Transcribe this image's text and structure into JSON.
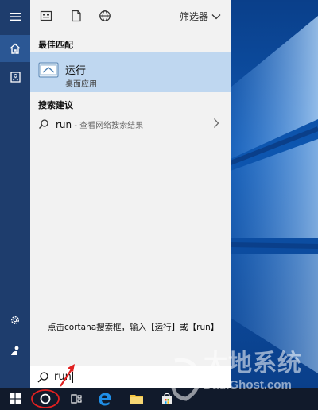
{
  "toolbar": {
    "filter_label": "筛选器"
  },
  "sections": {
    "best_match": "最佳匹配",
    "suggestions": "搜索建议"
  },
  "best_match": {
    "title": "运行",
    "subtitle": "桌面应用"
  },
  "suggestion": {
    "query": "run",
    "hint": " - 查看网络搜索结果"
  },
  "annotation": "点击cortana搜索框，输入【运行】或【run】",
  "search_box": {
    "value": "run"
  },
  "watermark": {
    "cn": "大地系统",
    "en": "DadiGhost.com"
  },
  "colors": {
    "accent": "#2b5794",
    "selection": "#bfd7f0",
    "rail": "#1e3d6d",
    "annotation_circle": "#e02020"
  },
  "icons": {
    "rail": [
      "hamburger-icon",
      "home-icon",
      "notebook-icon",
      "settings-icon",
      "feedback-icon"
    ],
    "toolbar": [
      "apps-icon",
      "documents-icon",
      "web-icon"
    ],
    "taskbar": [
      "windows-start-icon",
      "cortana-circle-icon",
      "task-view-icon",
      "edge-icon",
      "file-explorer-icon",
      "store-icon"
    ]
  }
}
